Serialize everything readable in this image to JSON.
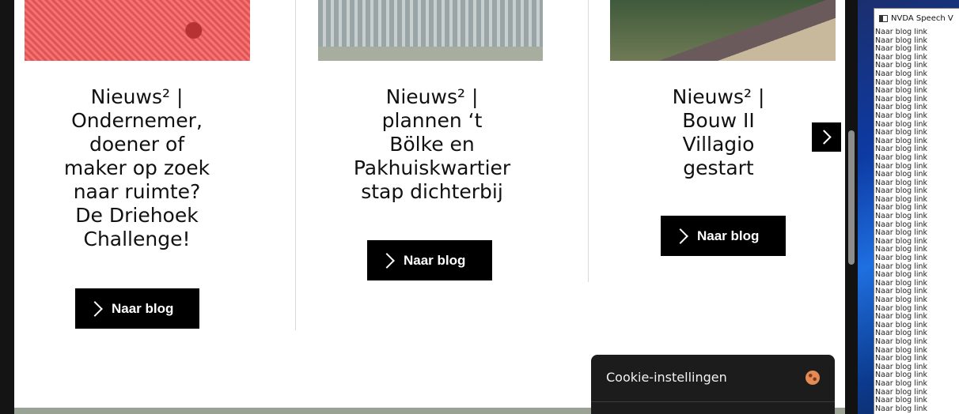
{
  "cards": [
    {
      "title_lines": [
        "Nieuws² |",
        "Ondernemer,",
        "doener of",
        "maker op zoek",
        "naar ruimte?",
        "De Driehoek",
        "Challenge!"
      ],
      "button_label": "Naar blog"
    },
    {
      "title_lines": [
        "Nieuws² |",
        "plannen ‘t",
        "Bölke en",
        "Pakhuiskwartier",
        "stap dichterbij"
      ],
      "button_label": "Naar blog"
    },
    {
      "title_lines": [
        "Nieuws² |",
        "Bouw II",
        "Villagio",
        "gestart"
      ],
      "button_label": "Naar blog"
    }
  ],
  "carousel": {
    "next_icon": "chevron-right-icon"
  },
  "cookie_panel": {
    "title": "Cookie-instellingen",
    "icon": "cookie-icon"
  },
  "nvda": {
    "window_title": "NVDA Speech V",
    "log_lines": [
      "Naar blog  link",
      "Naar blog  link",
      "Naar blog  link",
      "Naar blog  link",
      "Naar blog  link",
      "Naar blog  link",
      "Naar blog  link",
      "Naar blog  link",
      "Naar blog  link",
      "Naar blog  link",
      "Naar blog  link",
      "Naar blog  link",
      "Naar blog  link",
      "Naar blog  link",
      "Naar blog  link",
      "Naar blog  link",
      "Naar blog  link",
      "Naar blog  link",
      "Naar blog  link",
      "Naar blog  link",
      "Naar blog  link",
      "Naar blog  link",
      "Naar blog  link",
      "Naar blog  link",
      "Naar blog  link",
      "Naar blog  link",
      "Naar blog  link",
      "Naar blog  link",
      "Naar blog  link",
      "Naar blog  link",
      "Naar blog  link",
      "Naar blog  link",
      "Naar blog  link",
      "Naar blog  link",
      "Naar blog  link",
      "Naar blog  link",
      "Naar blog  link",
      "Naar blog  link",
      "Naar blog  link",
      "Naar blog  link",
      "Naar blog  link",
      "Naar blog  link",
      "Naar blog  link",
      "Naar blog  link",
      "Naar blog  link",
      "Naar blog  link"
    ]
  },
  "colors": {
    "button_bg": "#000000",
    "cookie_panel_bg": "#1c1c1c",
    "page_bg": "#ffffff",
    "footer_strip": "#9aa295"
  }
}
